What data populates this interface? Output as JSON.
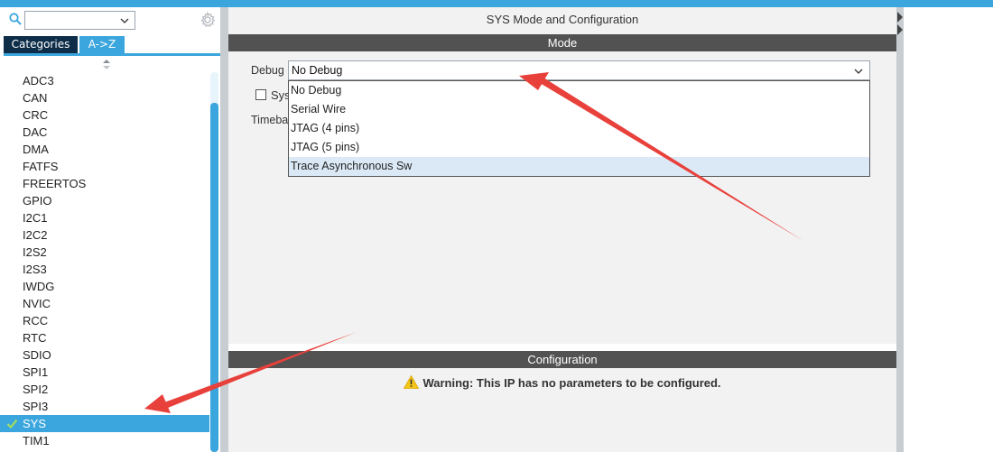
{
  "app": {
    "accent_color": "#3ba6dd",
    "dark_tab_color": "#0d2d49",
    "section_header_color": "#525252"
  },
  "sidebar": {
    "search": {
      "value": "",
      "placeholder": ""
    },
    "tabs": [
      {
        "label": "Categories",
        "active": false
      },
      {
        "label": "A->Z",
        "active": true
      }
    ],
    "items": [
      {
        "label": "ADC3"
      },
      {
        "label": "CAN"
      },
      {
        "label": "CRC"
      },
      {
        "label": "DAC"
      },
      {
        "label": "DMA"
      },
      {
        "label": "FATFS"
      },
      {
        "label": "FREERTOS"
      },
      {
        "label": "GPIO"
      },
      {
        "label": "I2C1"
      },
      {
        "label": "I2C2"
      },
      {
        "label": "I2S2"
      },
      {
        "label": "I2S3"
      },
      {
        "label": "IWDG"
      },
      {
        "label": "NVIC"
      },
      {
        "label": "RCC"
      },
      {
        "label": "RTC"
      },
      {
        "label": "SDIO"
      },
      {
        "label": "SPI1"
      },
      {
        "label": "SPI2"
      },
      {
        "label": "SPI3"
      },
      {
        "label": "SYS",
        "selected": true
      },
      {
        "label": "TIM1"
      }
    ]
  },
  "main": {
    "title": "SYS Mode and Configuration",
    "mode": {
      "header": "Mode",
      "debug_label": "Debug",
      "debug_value": "No Debug",
      "sys_label_partial": "Sys",
      "timebase_label_partial": "Timeba",
      "options": [
        {
          "label": "No Debug"
        },
        {
          "label": "Serial Wire"
        },
        {
          "label": "JTAG (4 pins)"
        },
        {
          "label": "JTAG (5 pins)"
        },
        {
          "label": "Trace Asynchronous Sw",
          "hovered": true
        }
      ]
    },
    "configuration": {
      "header": "Configuration",
      "warning": "Warning: This IP has no parameters to be configured."
    }
  },
  "icons": {
    "search": "search-icon",
    "gear": "gear-icon",
    "chevron": "chevron-down-icon",
    "check": "check-icon",
    "warning": "warning-icon",
    "sort": "sort-arrows-icon"
  },
  "annotation": {
    "arrow_color": "#e8403a"
  }
}
